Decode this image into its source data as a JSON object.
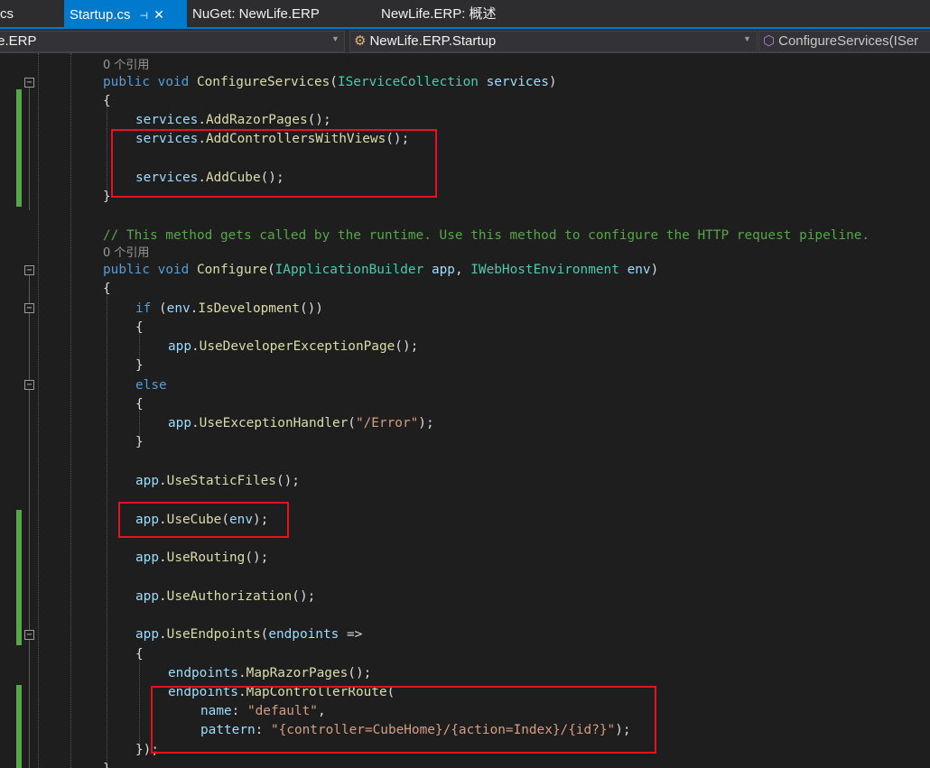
{
  "tabs": [
    {
      "label": "cs",
      "active": false
    },
    {
      "label": "Startup.cs",
      "active": true,
      "pin_icon": "pin-icon",
      "close_icon": "close-icon"
    },
    {
      "label": "NuGet: NewLife.ERP",
      "active": false
    },
    {
      "label": "NewLife.ERP: 概述",
      "active": false
    }
  ],
  "navbar": {
    "project": "fe.ERP",
    "class": "NewLife.ERP.Startup",
    "member": "ConfigureServices(ISer"
  },
  "code": {
    "ref0": "0 个引用",
    "l1": {
      "kw1": "public",
      "kw2": "void",
      "method": "ConfigureServices",
      "p1": "(",
      "type": "IServiceCollection",
      "sp": " ",
      "var": "services",
      "p2": ")"
    },
    "brace_open": "{",
    "brace_close": "}",
    "l3": {
      "var": "services",
      "dot": ".",
      "method": "AddRazorPages",
      "tail": "();"
    },
    "l4": {
      "var": "services",
      "dot": ".",
      "method": "AddControllersWithViews",
      "tail": "();"
    },
    "l6": {
      "var": "services",
      "dot": ".",
      "method": "AddCube",
      "tail": "();"
    },
    "comment": "// This method gets called by the runtime. Use this method to configure the HTTP request pipeline.",
    "ref1": "0 个引用",
    "l9": {
      "kw1": "public",
      "kw2": "void",
      "method": "Configure",
      "p1": "(",
      "type1": "IApplicationBuilder",
      "sp1": " ",
      "var1": "app",
      "comma": ", ",
      "type2": "IWebHostEnvironment",
      "sp2": " ",
      "var2": "env",
      "p2": ")"
    },
    "l11": {
      "kw": "if",
      "p1": " (",
      "var": "env",
      "dot": ".",
      "method": "IsDevelopment",
      "tail": "())"
    },
    "l13": {
      "var": "app",
      "dot": ".",
      "method": "UseDeveloperExceptionPage",
      "tail": "();"
    },
    "else": "else",
    "l17": {
      "var": "app",
      "dot": ".",
      "method": "UseExceptionHandler",
      "p1": "(",
      "str": "\"/Error\"",
      "tail": ");"
    },
    "l20": {
      "var": "app",
      "dot": ".",
      "method": "UseStaticFiles",
      "tail": "();"
    },
    "l22": {
      "var": "app",
      "dot": ".",
      "method": "UseCube",
      "p1": "(",
      "var2": "env",
      "tail": ");"
    },
    "l24": {
      "var": "app",
      "dot": ".",
      "method": "UseRouting",
      "tail": "();"
    },
    "l26": {
      "var": "app",
      "dot": ".",
      "method": "UseAuthorization",
      "tail": "();"
    },
    "l28": {
      "var": "app",
      "dot": ".",
      "method": "UseEndpoints",
      "p1": "(",
      "var2": "endpoints",
      "tail": " =>"
    },
    "l30": {
      "var": "endpoints",
      "dot": ".",
      "method": "MapRazorPages",
      "tail": "();"
    },
    "l31": {
      "var": "endpoints",
      "dot": ".",
      "method": "MapControllerRoute",
      "tail": "("
    },
    "l32": {
      "var": "name",
      "colon": ": ",
      "str": "\"default\"",
      "tail": ","
    },
    "l33": {
      "var": "pattern",
      "colon": ": ",
      "str": "\"{controller=CubeHome}/{action=Index}/{id?}\"",
      "tail": ");"
    },
    "l34": "});",
    "l35": "}"
  },
  "colors": {
    "accent": "#007acc",
    "highlight": "#e81123",
    "keyword": "#569cd6",
    "type": "#4ec9b0",
    "method": "#dcdcaa",
    "variable": "#9cdcfe",
    "string": "#d69d85",
    "comment": "#57a64a"
  }
}
